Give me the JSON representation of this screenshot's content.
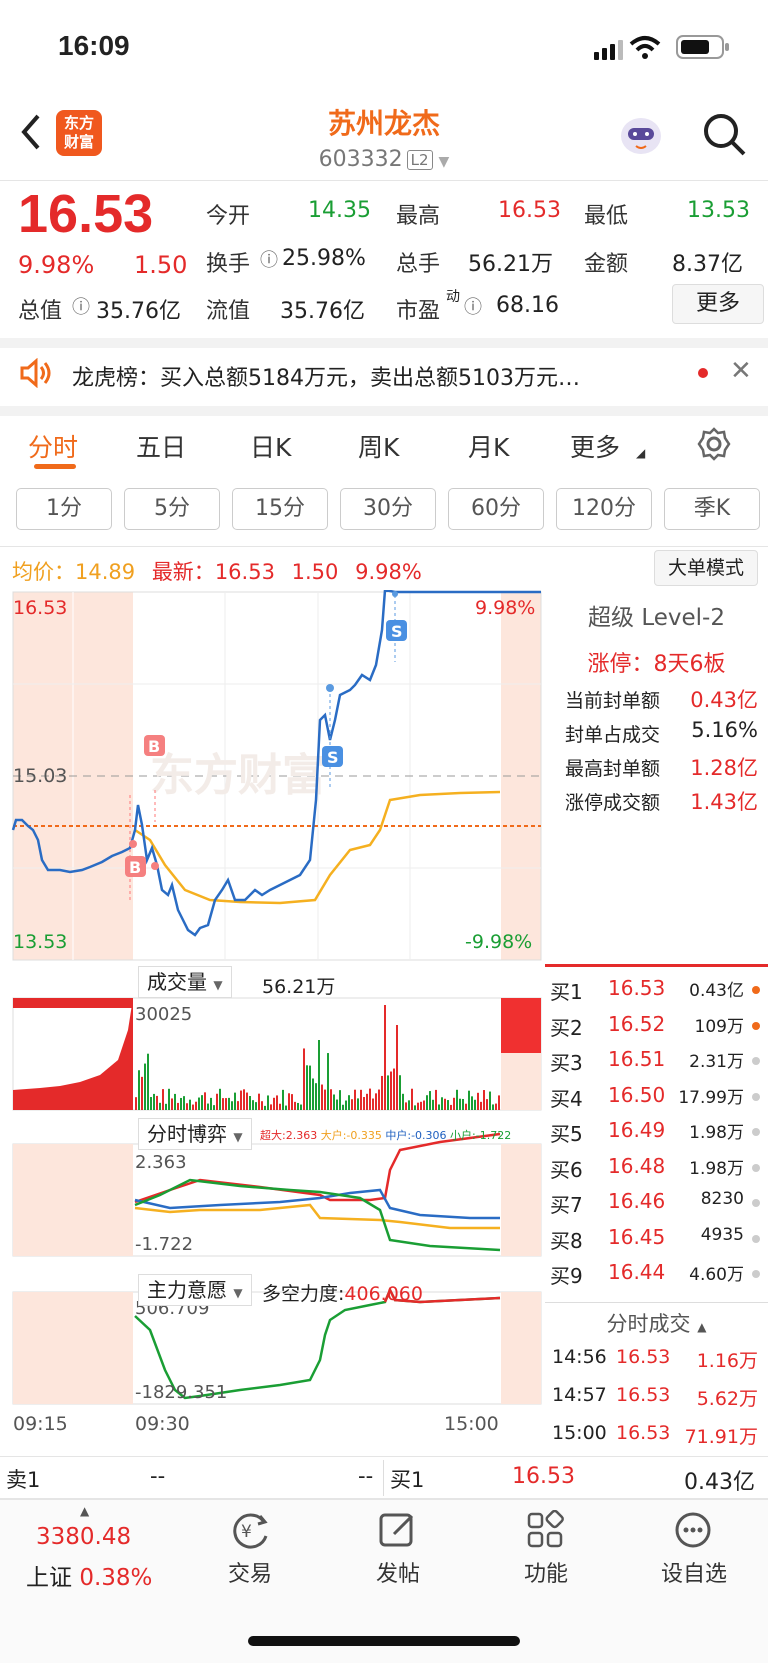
{
  "status": {
    "time": "16:09"
  },
  "header": {
    "title": "苏州龙杰",
    "code": "603332",
    "level": "L2",
    "logo": "东方\n财富"
  },
  "quote": {
    "price": "16.53",
    "pct": "9.98%",
    "chg": "1.50",
    "rows": [
      [
        {
          "l": "今开",
          "v": "14.35",
          "c": "green"
        },
        {
          "l": "最高",
          "v": "16.53",
          "c": "red"
        },
        {
          "l": "最低",
          "v": "13.53",
          "c": "green"
        }
      ],
      [
        {
          "l": "换手",
          "v": "25.98%",
          "c": "gray"
        },
        {
          "l": "总手",
          "v": "56.21万",
          "c": "gray"
        },
        {
          "l": "金额",
          "v": "8.37亿",
          "c": "gray"
        }
      ],
      [
        {
          "l": "总值",
          "v": "35.76亿",
          "c": "gray"
        },
        {
          "l": "流值",
          "v": "35.76亿",
          "c": "gray"
        },
        {
          "l": "市盈",
          "v": "68.16",
          "c": "gray"
        }
      ]
    ],
    "pe_sup": "动",
    "more": "更多"
  },
  "notice": {
    "text": "龙虎榜：买入总额5184万元，卖出总额5103万元…"
  },
  "tabs": [
    "分时",
    "五日",
    "日K",
    "周K",
    "月K",
    "更多"
  ],
  "periods": [
    "1分",
    "5分",
    "15分",
    "30分",
    "60分",
    "120分",
    "季K"
  ],
  "chart_info": {
    "avg_label": "均价：",
    "avg": "14.89",
    "last_label": "最新：",
    "last": "16.53",
    "chg": "1.50",
    "pct": "9.98%",
    "mode_btn": "大单模式"
  },
  "chart_labels": {
    "top": "16.53",
    "mid": "15.03",
    "bot": "13.53",
    "top_pct": "9.98%",
    "bot_pct": "-9.98%",
    "watermark": "东方财富",
    "b": "B",
    "s": "S"
  },
  "vol": {
    "label": "成交量",
    "total": "56.21万",
    "max": "30025"
  },
  "game": {
    "label": "分时博弈",
    "legend": [
      {
        "t": "超大:2.363",
        "c": "#e42a2a"
      },
      {
        "t": "大户:-0.335",
        "c": "#f0a020"
      },
      {
        "t": "中户:-0.306",
        "c": "#2060c0"
      },
      {
        "t": "小户:-1.722",
        "c": "#1a9e34"
      }
    ],
    "max": "2.363",
    "min": "-1.722"
  },
  "intent": {
    "label": "主力意愿",
    "force_label": "多空力度:",
    "force": "406.060",
    "max": "506.709",
    "min": "-1829.351"
  },
  "time_axis": {
    "t1": "09:15",
    "t2": "09:30",
    "t3": "15:00"
  },
  "level2": {
    "title": "超级 Level-2",
    "zt_label": "涨停：",
    "zt": "8天6板",
    "items": [
      {
        "l": "当前封单额",
        "v": "0.43亿",
        "c": "red"
      },
      {
        "l": "封单占成交",
        "v": "5.16%",
        "c": "gray"
      },
      {
        "l": "最高封单额",
        "v": "1.28亿",
        "c": "red"
      },
      {
        "l": "涨停成交额",
        "v": "1.43亿",
        "c": "red"
      }
    ]
  },
  "orderbook": [
    {
      "n": "买1",
      "p": "16.53",
      "q": "0.43亿",
      "dot": "#f06a1a"
    },
    {
      "n": "买2",
      "p": "16.52",
      "q": "109万",
      "dot": "#f06a1a"
    },
    {
      "n": "买3",
      "p": "16.51",
      "q": "2.31万",
      "dot": "#ccc"
    },
    {
      "n": "买4",
      "p": "16.50",
      "q": "17.99万",
      "dot": "#ccc"
    },
    {
      "n": "买5",
      "p": "16.49",
      "q": "1.98万",
      "dot": "#ccc"
    },
    {
      "n": "买6",
      "p": "16.48",
      "q": "1.98万",
      "dot": "#ccc"
    },
    {
      "n": "买7",
      "p": "16.46",
      "q": "8230",
      "dot": "#ccc"
    },
    {
      "n": "买8",
      "p": "16.45",
      "q": "4935",
      "dot": "#ccc"
    },
    {
      "n": "买9",
      "p": "16.44",
      "q": "4.60万",
      "dot": "#ccc"
    }
  ],
  "ticks": {
    "title": "分时成交",
    "rows": [
      {
        "t": "14:56",
        "p": "16.53",
        "q": "1.16万"
      },
      {
        "t": "14:57",
        "p": "16.53",
        "q": "5.62万"
      },
      {
        "t": "15:00",
        "p": "16.53",
        "q": "71.91万"
      }
    ]
  },
  "bidask": {
    "sell_label": "卖1",
    "sell_p": "--",
    "sell_q": "--",
    "buy_label": "买1",
    "buy_p": "16.53",
    "buy_q": "0.43亿"
  },
  "bottom": {
    "index": "3380.48",
    "index_name": "上证",
    "index_pct": "0.38%",
    "nav": [
      "交易",
      "发帖",
      "功能",
      "设自选"
    ]
  }
}
